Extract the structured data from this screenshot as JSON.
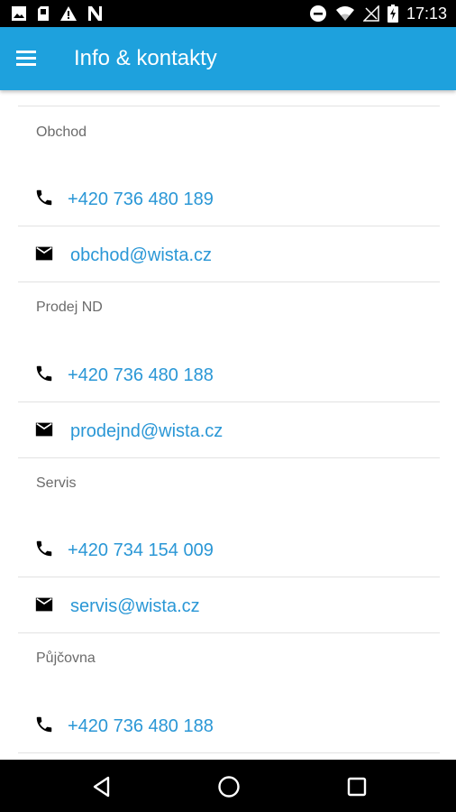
{
  "status_bar": {
    "time": "17:13",
    "left_icons": [
      "image-icon",
      "sd-card-icon",
      "warning-icon",
      "n-icon"
    ],
    "right_icons": [
      "dnd-icon",
      "wifi-icon",
      "no-signal-icon",
      "battery-charging-icon"
    ]
  },
  "app_bar": {
    "title": "Info & kontakty",
    "menu_icon": "hamburger-menu-icon",
    "color": "#1ea1dd"
  },
  "sections": [
    {
      "label": "Obchod",
      "phone": "+420 736 480 189",
      "email": "obchod@wista.cz"
    },
    {
      "label": "Prodej ND",
      "phone": "+420 736 480 188",
      "email": "prodejnd@wista.cz"
    },
    {
      "label": "Servis",
      "phone": "+420 734 154 009",
      "email": "servis@wista.cz"
    },
    {
      "label": "Půjčovna",
      "phone": "+420 736 480 188"
    }
  ],
  "link_color": "#2a97d6",
  "nav_bar": {
    "buttons": [
      "back-icon",
      "home-icon",
      "recents-icon"
    ]
  }
}
